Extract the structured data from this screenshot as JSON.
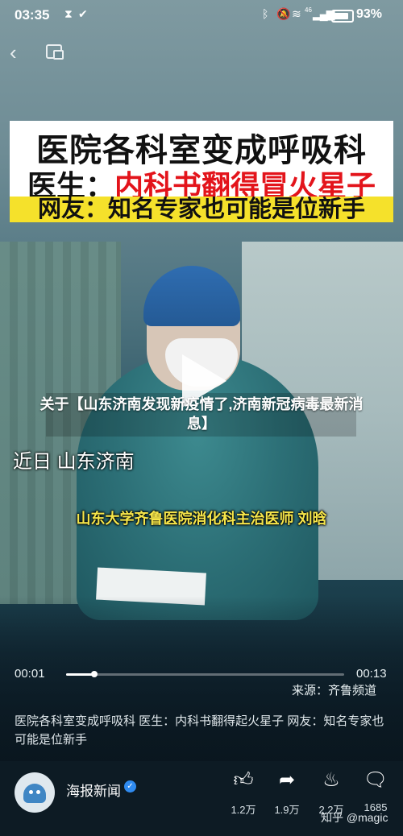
{
  "status_bar": {
    "time": "03:35",
    "battery": "93%",
    "network": "46"
  },
  "nav": {
    "back_icon": "chevron-left-icon",
    "pip_icon": "picture-in-picture-icon"
  },
  "video": {
    "headline_line1": "医院各科室变成呼吸科",
    "headline_line2_lead": "医生：",
    "headline_line2_red": "内科书翻得冒火星子",
    "headline_line3": "网友：知名专家也可能是位新手",
    "article_title": "关于【山东济南发现新疫情了,济南新冠病毒最新消息】",
    "caption_location": "近日 山东济南",
    "caption_doctor": "山东大学齐鲁医院消化科主治医师 刘晗"
  },
  "player": {
    "current_time": "00:01",
    "total_time": "00:13",
    "progress_fraction": 0.1,
    "source": "来源：齐鲁频道"
  },
  "description": "医院各科室变成呼吸科 医生：内科书翻得起火星子 网友：知名专家也可能是位新手",
  "bottom_bar": {
    "author": "海报新闻",
    "like_count": "1.2万",
    "share_count": "1.9万",
    "favorite_count": "2.2万",
    "comment_count": "1685",
    "watermark": "知乎 @magic"
  },
  "colors": {
    "headline_red": "#e3141b",
    "headline_yellow": "#f5e12b",
    "caption_yellow": "#f6e64a",
    "bottom_bar_bg": "#0d1b24",
    "verified_blue": "#2f8bf0"
  }
}
